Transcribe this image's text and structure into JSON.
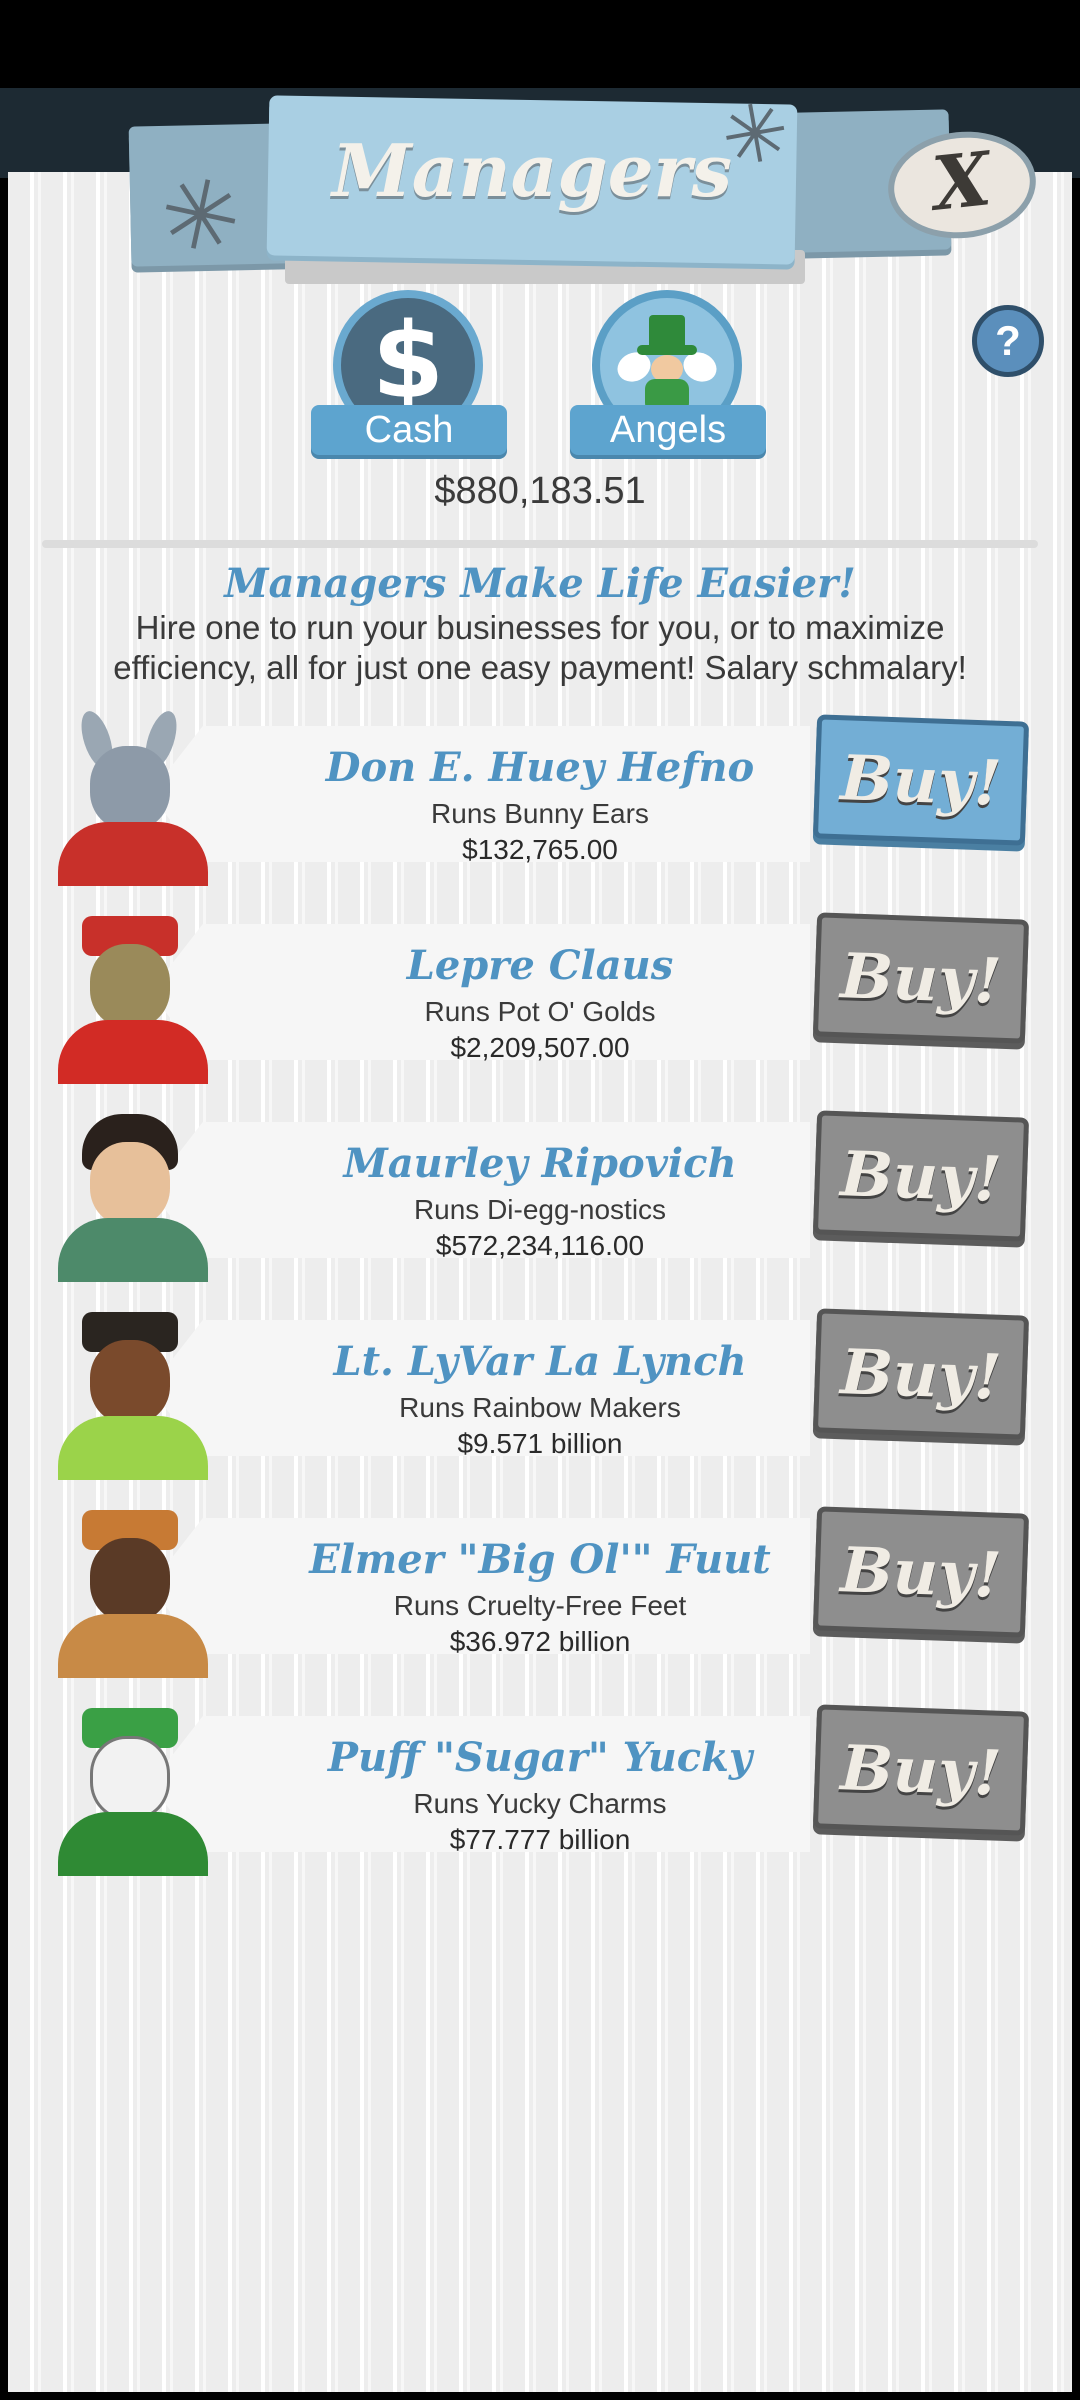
{
  "header": {
    "title": "Managers",
    "close_label": "X",
    "help_label": "?"
  },
  "currency": {
    "cash_label": "Cash",
    "angels_label": "Angels",
    "balance": "$880,183.51",
    "dollar_glyph": "$"
  },
  "intro": {
    "title": "Managers Make Life Easier!",
    "text": "Hire one to run your businesses for you, or to maximize efficiency, all for just one easy payment! Salary schmalary!"
  },
  "managers": [
    {
      "name": "Don E. Huey Hefno",
      "runs": "Runs Bunny Ears",
      "price": "$132,765.00",
      "buy": "Buy!",
      "affordable": true
    },
    {
      "name": "Lepre Claus",
      "runs": "Runs Pot O' Golds",
      "price": "$2,209,507.00",
      "buy": "Buy!",
      "affordable": false
    },
    {
      "name": "Maurley Ripovich",
      "runs": "Runs Di-egg-nostics",
      "price": "$572,234,116.00",
      "buy": "Buy!",
      "affordable": false
    },
    {
      "name": "Lt. LyVar La Lynch",
      "runs": "Runs Rainbow Makers",
      "price": "$9.571 billion",
      "buy": "Buy!",
      "affordable": false
    },
    {
      "name": "Elmer \"Big Ol'\" Fuut",
      "runs": "Runs Cruelty-Free Feet",
      "price": "$36.972 billion",
      "buy": "Buy!",
      "affordable": false
    },
    {
      "name": "Puff \"Sugar\" Yucky",
      "runs": "Runs Yucky Charms",
      "price": "$77.777 billion",
      "buy": "Buy!",
      "affordable": false
    }
  ],
  "colors": {
    "accent_blue": "#4f93c2",
    "buy_active": "#73aed5",
    "buy_disabled": "#8e8e8e",
    "panel_bg": "#ededed"
  }
}
